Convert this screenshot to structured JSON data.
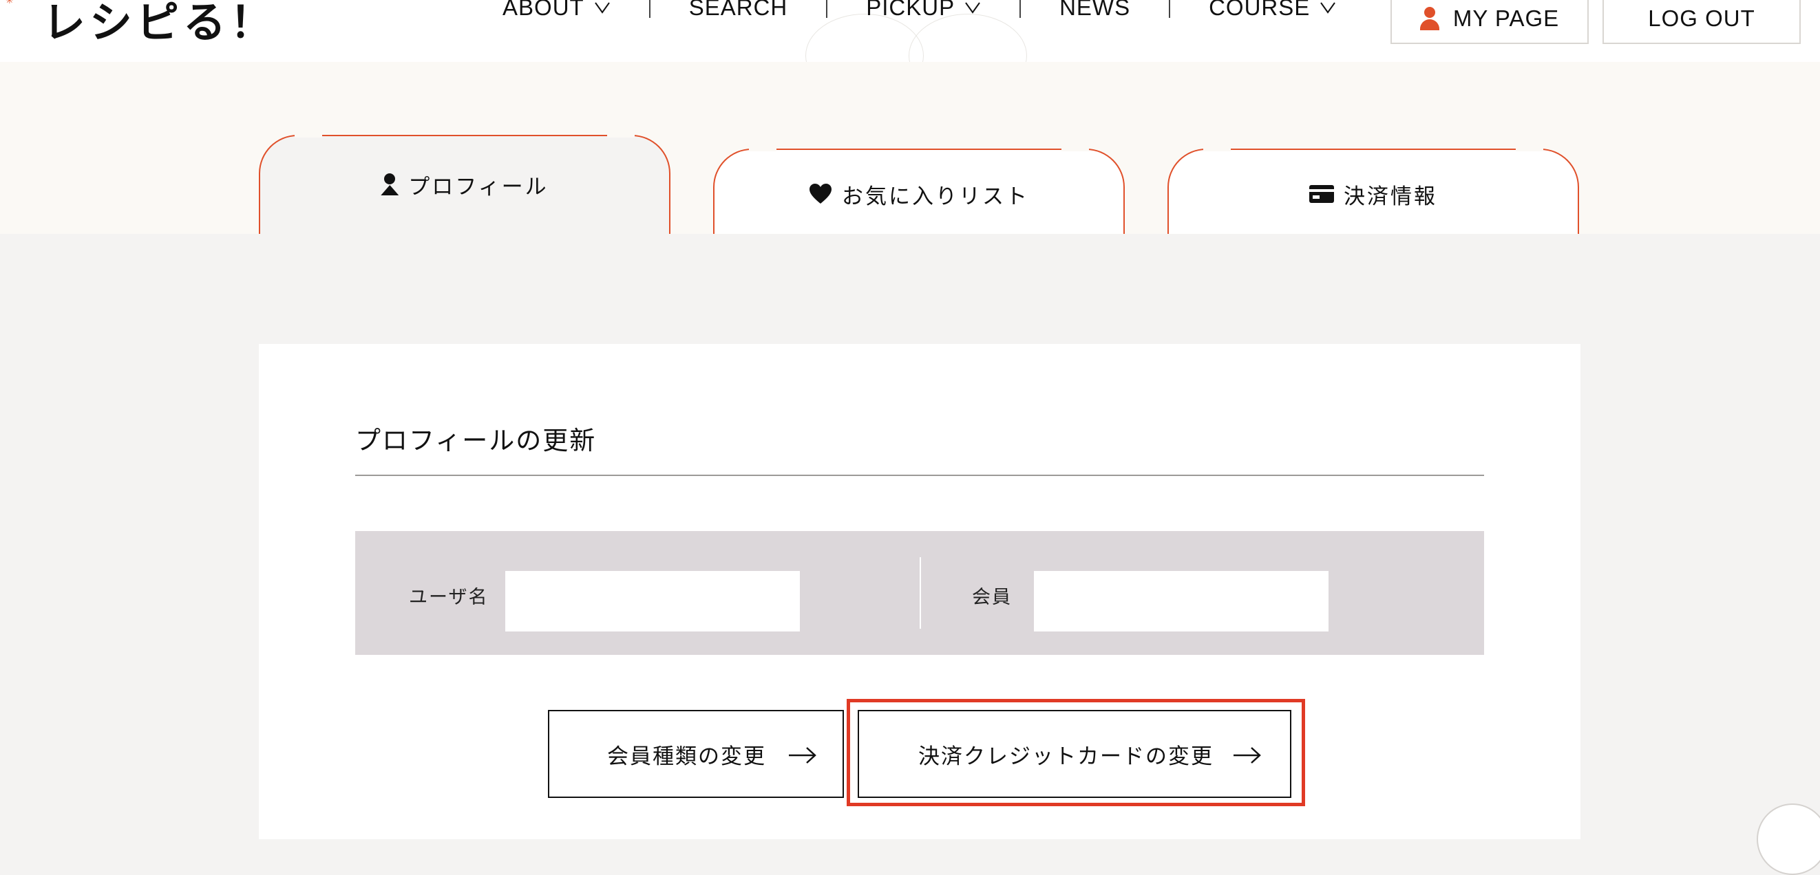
{
  "header": {
    "logo": "レシピる！",
    "nav": [
      {
        "label": "ABOUT",
        "has_dropdown": true
      },
      {
        "label": "SEARCH",
        "has_dropdown": false
      },
      {
        "label": "PICKUP",
        "has_dropdown": true
      },
      {
        "label": "NEWS",
        "has_dropdown": false
      },
      {
        "label": "COURSE",
        "has_dropdown": true
      }
    ],
    "mypage_label": "MY PAGE",
    "logout_label": "LOG OUT",
    "accent_color": "#e0502a"
  },
  "tabs": [
    {
      "label": "プロフィール",
      "icon": "person-icon",
      "active": true
    },
    {
      "label": "お気に入りリスト",
      "icon": "heart-icon",
      "active": false
    },
    {
      "label": "決済情報",
      "icon": "card-icon",
      "active": false
    }
  ],
  "profile": {
    "title": "プロフィールの更新",
    "username_label": "ユーザ名",
    "username_value": "",
    "member_label": "会員",
    "member_value": ""
  },
  "actions": {
    "change_plan_label": "会員種類の変更",
    "change_card_label": "決済クレジットカードの変更",
    "highlight_color": "#e03a25"
  }
}
